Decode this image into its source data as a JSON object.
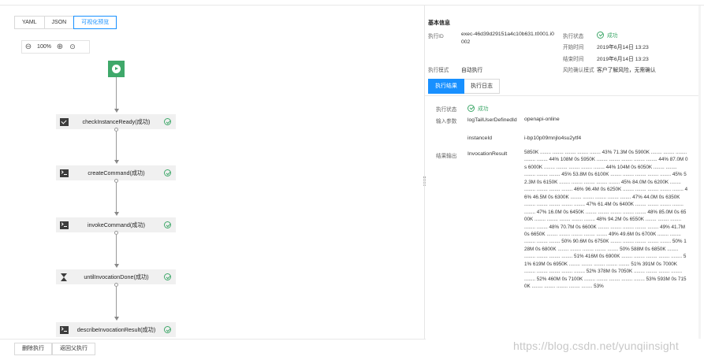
{
  "view_tabs": [
    "YAML",
    "JSON",
    "可视化预览"
  ],
  "active_view_tab": 2,
  "zoom": {
    "level": "100%",
    "zoom_out_icon": "minus-circle-icon",
    "zoom_in_icon": "plus-circle-icon",
    "fit_icon": "locate-icon"
  },
  "flow": {
    "start_icon": "play-icon",
    "tasks": [
      {
        "label": "checkInstanceReady(成功)",
        "icon": "check-square-icon"
      },
      {
        "label": "createCommand(成功)",
        "icon": "terminal-icon"
      },
      {
        "label": "invokeCommand(成功)",
        "icon": "terminal-icon"
      },
      {
        "label": "untilInvocationDone(成功)",
        "icon": "hourglass-icon"
      },
      {
        "label": "describeInvocationResult(成功)",
        "icon": "terminal-icon"
      }
    ],
    "status_icon": "check-circle-icon"
  },
  "bottom_buttons": [
    "删除执行",
    "返回父执行"
  ],
  "basic_info": {
    "title": "基本信息",
    "exec_id_label": "执行ID",
    "exec_id_value": "exec-46d39d29151a4c10b631.t0001.i0002",
    "exec_mode_label": "执行模式",
    "exec_mode_value": "自动执行",
    "exec_status_label": "执行状态",
    "exec_status_value": "成功",
    "start_time_label": "开始时间",
    "start_time_value": "2019年6月14日 13:23",
    "end_time_label": "结束时间",
    "end_time_value": "2019年6月14日 13:23",
    "risk_label": "风险确认模式",
    "risk_value": "客户了解风险，无需确认"
  },
  "result_tabs": [
    "执行结果",
    "执行日志"
  ],
  "active_result_tab": 0,
  "result": {
    "status_label": "执行状态",
    "status_value": "成功",
    "output_params_label": "输入参数",
    "param1_name": "logTailUserDefinedId",
    "param1_value": "openapi-online",
    "param2_name": "instanceId",
    "param2_value": "i-bp10p09mnjlo4su2ytf4",
    "output_label": "结果输出",
    "output_name": "InvocationResult",
    "output_value": "5850K ........ ........ ........ ........ ........ 43% 71.3M 0s 5900K ........ ........ ........ ........ ........ 44% 108M 0s 5950K ........ ........ ........ ........ ........ 44% 87.0M 0s 6000K ........ ........ ........ ........ ........ 44% 104M 0s 6050K ........ ........ ........ ........ ........ 45% 53.8M 0s 6100K ........ ........ ........ ........ ........ 45% 52.3M 0s 6150K ........ ........ ........ ........ ........ 45% 84.0M 0s 6200K ........ ........ ........ ........ ........ 46% 96.4M 0s 6250K ........ ........ ........ ........ ........ 46% 46.5M 0s 6300K ........ ........ ........ ........ ........ 47% 44.0M 0s 6350K ........ ........ ........ ........ ........ 47% 61.4M 0s 6400K ........ ........ ........ ........ ........ 47% 16.0M 0s 6450K ........ ........ ........ ........ ........ 48% 85.0M 0s 6500K ........ ........ ........ ........ ........ 48% 94.2M 0s 6550K ........ ........ ........ ........ ........ 48% 70.7M 0s 6600K ........ ........ ........ ........ ........ 49% 41.7M 0s 6650K ........ ........ ........ ........ ........ 49% 49.6M 0s 6700K ........ ........ ........ ........ ........ 50% 90.6M 0s 6750K ........ ........ ........ ........ ........ 50% 128M 0s 6800K ........ ........ ........ ........ ........ 50% 588M 0s 6850K ........ ........ ........ ........ ........ 51% 416M 0s 6900K ........ ........ ........ ........ ........ 51% 619M 0s 6950K ........ ........ ........ ........ ........ 51% 391M 0s 7000K ........ ........ ........ ........ ........ 52% 378M 0s 7050K ........ ........ ........ ........ ........ 52% 460M 0s 7100K ........ ........ ........ ........ ........ 53% 593M 0s 7150K ........ ........ ........ ........ ........ 53%"
  },
  "watermark": "https://blog.csdn.net/yunqiinsight",
  "colors": {
    "accent": "#1890ff",
    "success": "#3fa86a",
    "node_bg": "#f0f0f0"
  }
}
